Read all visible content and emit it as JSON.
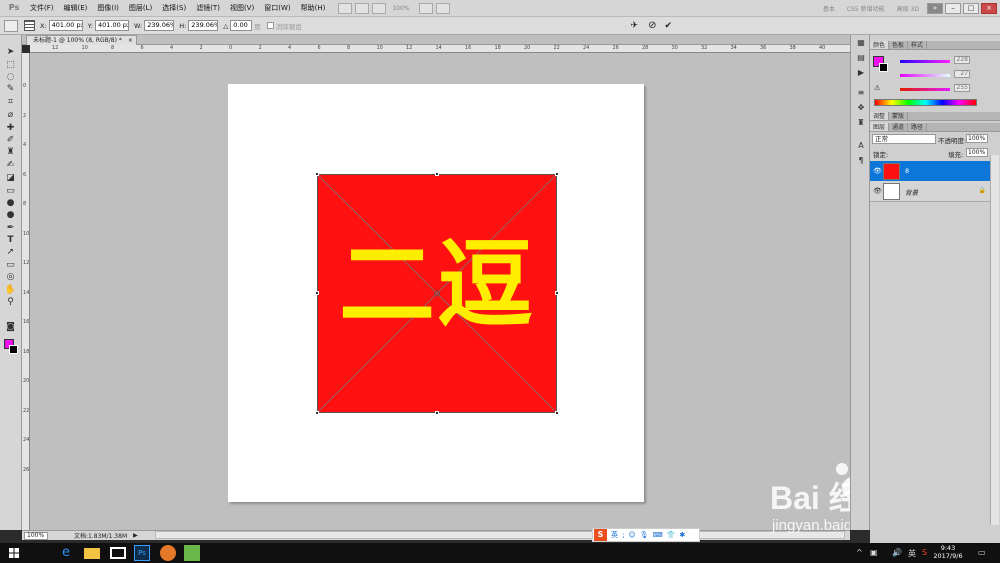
{
  "app": {
    "logo": "Ps"
  },
  "menu": [
    {
      "label": "文件(F)"
    },
    {
      "label": "编辑(E)"
    },
    {
      "label": "图像(I)"
    },
    {
      "label": "图层(L)"
    },
    {
      "label": "选择(S)"
    },
    {
      "label": "滤镜(T)"
    },
    {
      "label": "视图(V)"
    },
    {
      "label": "窗口(W)"
    },
    {
      "label": "帮助(H)"
    }
  ],
  "menu_zoom": "100%",
  "workspace": [
    "基本",
    "CS5 新增功能",
    "高级 3D"
  ],
  "window_buttons": {
    "extend": "»",
    "min": "–",
    "max": "□",
    "close": "×"
  },
  "options": {
    "x_label": "X:",
    "x_value": "401.00 px",
    "y_label": "Y:",
    "y_value": "401.00 px",
    "w_label": "W:",
    "w_value": "239.06%",
    "h_label": "H:",
    "h_value": "239.06%",
    "angle_label": "△",
    "angle_value": "0.00",
    "degree": "度",
    "antialias_label": "消除锯齿",
    "cancel_icon": "⊘",
    "commit_icon": "✔"
  },
  "document_tab": {
    "title": "未标题-1 @ 100% (8, RGB/8) *",
    "close": "×"
  },
  "ruler_top": [
    "12",
    "10",
    "8",
    "6",
    "4",
    "2",
    "0",
    "2",
    "4",
    "6",
    "8",
    "10",
    "12",
    "14",
    "16",
    "18",
    "20",
    "22",
    "24",
    "26",
    "28",
    "30",
    "32",
    "34",
    "36",
    "38",
    "40"
  ],
  "ruler_left": [
    "0",
    "2",
    "4",
    "6",
    "8",
    "10",
    "12",
    "14",
    "16",
    "18",
    "20",
    "22",
    "24",
    "26"
  ],
  "canvas": {
    "text": "二逗",
    "rect_color": "#ff1111",
    "text_color": "#ffee00"
  },
  "status": {
    "zoom": "100%",
    "doc_info": "文档:1.83M/1.38M"
  },
  "ime": {
    "logo": "S",
    "lang": "英"
  },
  "color_panel": {
    "tabs": [
      "颜色",
      "色板",
      "样式"
    ],
    "r_value": "228",
    "g_value": "27",
    "b_value": "255",
    "fg": "#ee11ee",
    "bg": "#000000"
  },
  "adjust_tabs": [
    "调整",
    "蒙版"
  ],
  "layers_panel": {
    "tabs": [
      "图层",
      "通道",
      "路径"
    ],
    "blend_mode": "正常",
    "opacity_label": "不透明度:",
    "opacity_value": "100%",
    "lock_label": "锁定:",
    "fill_label": "填充:",
    "fill_value": "100%",
    "layers": [
      {
        "name": "8",
        "selected": true
      },
      {
        "name": "背景",
        "selected": false
      }
    ]
  },
  "watermark": {
    "big": "Bai  经验",
    "small": "jingyan.baidu.com"
  },
  "taskbar": {
    "time": "9:43",
    "date": "2017/9/6",
    "lang": "英"
  }
}
